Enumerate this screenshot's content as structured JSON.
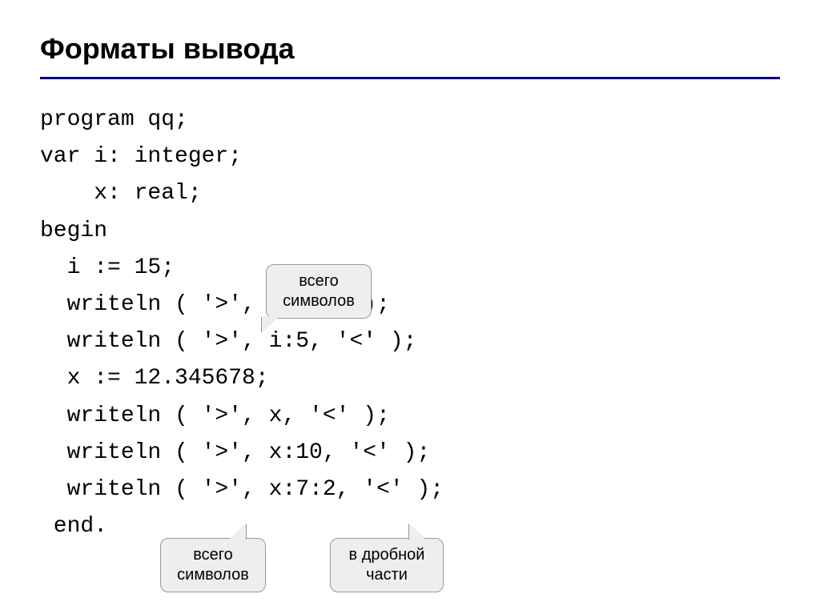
{
  "title": "Форматы вывода",
  "code": {
    "l1": "program qq;",
    "l2": "var i: integer;",
    "l3": "    x: real;",
    "l4": "begin",
    "l5": "  i := 15;",
    "l6": "  writeln ( '>', i, '<' );",
    "l7": "  writeln ( '>', i:5, '<' );",
    "l8": "  x := 12.345678;",
    "l9": "  writeln ( '>', x, '<' );",
    "l10": "  writeln ( '>', x:10, '<' );",
    "l11": "  writeln ( '>', x:7:2, '<' );",
    "l12": " end."
  },
  "callouts": {
    "c1_line1": "всего",
    "c1_line2": "символов",
    "c2_line1": "всего",
    "c2_line2": "символов",
    "c3_line1": "в дробной",
    "c3_line2": "части"
  }
}
